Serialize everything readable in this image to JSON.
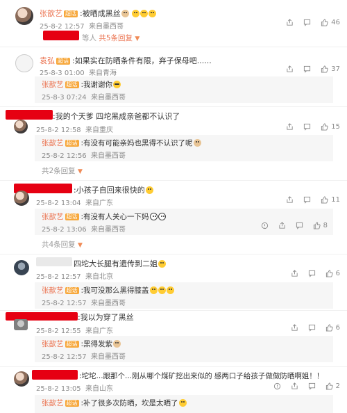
{
  "comments": [
    {
      "id": "c1",
      "name": "张歆艺",
      "badge": "超话",
      "text": ":被晒成黑丝",
      "meta": "25-8-2 12:57",
      "location": "来自墨西哥",
      "replies_prefix": "等人",
      "replies_label": "共5条回复",
      "likes": "46"
    },
    {
      "id": "c2",
      "name": "袁弘",
      "badge": "超话",
      "text": ":如果实在防晒条件有限，弃子保母吧......",
      "meta": "25-8-3 01:00",
      "location": "来自青海",
      "likes": "37",
      "reply": {
        "name": "张歆艺",
        "badge": "超话",
        "text": ":我谢谢你",
        "meta": "25-8-3 07:24",
        "location": "来自墨西哥"
      }
    },
    {
      "id": "c3",
      "text": ":我的个天爹 四坨黑成亲爸都不认识了",
      "meta": "25-8-2 12:58",
      "location": "来自重庆",
      "likes": "15",
      "reply": {
        "name": "张歆艺",
        "badge": "超话",
        "text": ":有没有可能亲妈也黑得不认识了呢",
        "meta": "25-8-2 12:56",
        "location": "来自墨西哥"
      },
      "more_label": "共2条回复"
    },
    {
      "id": "c4",
      "text": ":小孩子自回来很快的",
      "meta": "25-8-2 13:04",
      "location": "来自广东",
      "likes": "11",
      "reply": {
        "name": "张歆艺",
        "badge": "超话",
        "text": ":有没有人关心一下妈",
        "meta": "25-8-2 13:06",
        "location": "来自墨西哥",
        "likes": "8"
      },
      "more_label": "共4条回复"
    },
    {
      "id": "c5",
      "text": "四坨大长腿有遗传到二姐",
      "meta": "25-8-2 12:57",
      "location": "来自北京",
      "likes": "6",
      "reply": {
        "name": "张歆艺",
        "badge": "超话",
        "text": ":我可没那么黑得膝盖",
        "meta": "25-8-2 12:57",
        "location": "来自墨西哥"
      }
    },
    {
      "id": "c6",
      "text": ":我以为穿了黑丝",
      "meta": "25-8-2 12:55",
      "location": "来自广东",
      "likes": "6",
      "reply": {
        "name": "张歆艺",
        "badge": "超话",
        "text": ":黑得发紫",
        "meta": "25-8-2 12:57",
        "location": "来自墨西哥"
      }
    },
    {
      "id": "c7",
      "text": ":坨坨...跟那个...刚从哪个煤矿挖出来似的 感两口子给孩子做做防晒啊姐！！",
      "meta": "25-8-2 13:05",
      "location": "来自山东",
      "likes": "2",
      "reply": {
        "name": "张歆艺",
        "badge": "超话",
        "text": ":补了很多次防晒，坎是太晒了"
      }
    }
  ],
  "icons": {
    "share": "share-icon",
    "comment": "comment-icon",
    "like": "thumbs-up-icon",
    "report": "report-icon"
  },
  "colors": {
    "name": "#eb7350",
    "redaction": "#e60012",
    "badge": "#f7a83c",
    "meta": "#8a8a8a"
  }
}
